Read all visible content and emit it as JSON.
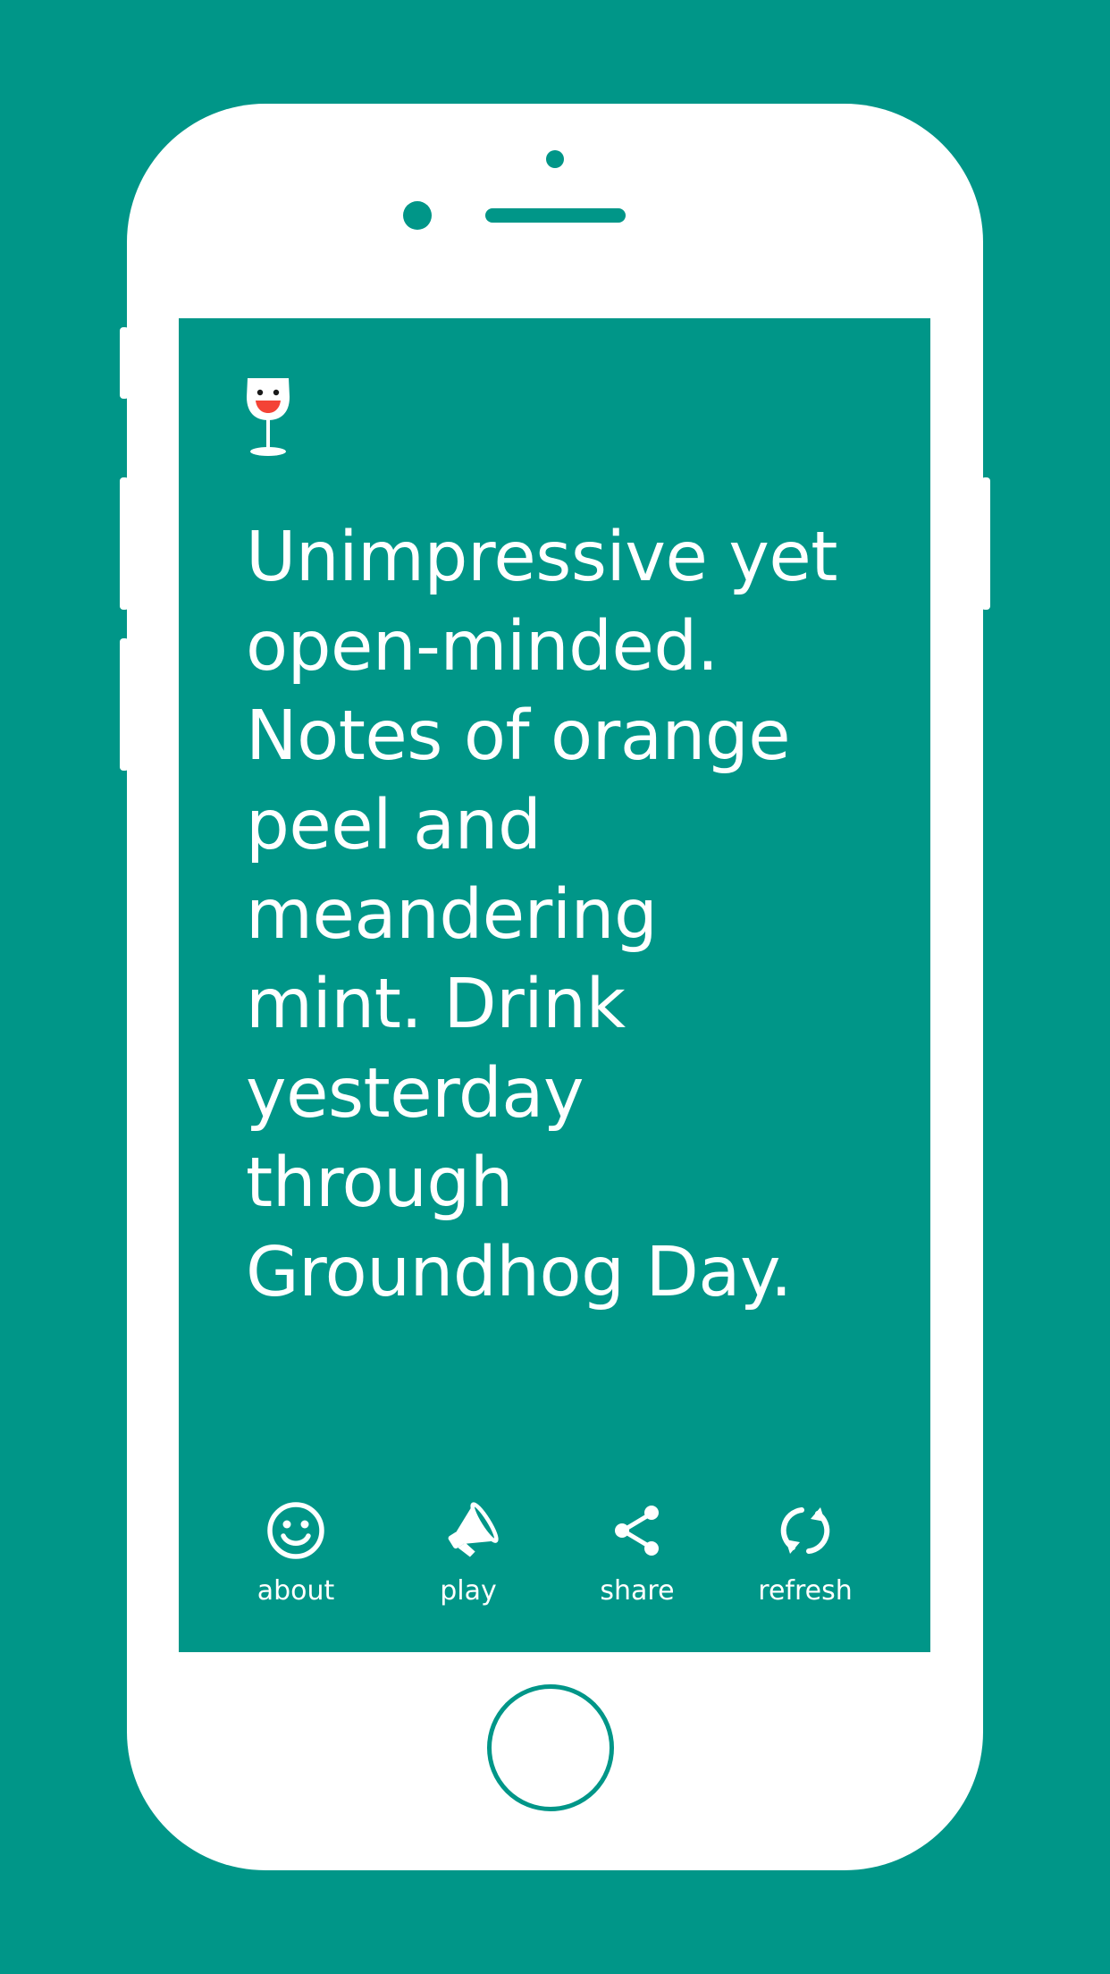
{
  "colors": {
    "background": "#009688",
    "phone_body": "#ffffff",
    "text": "#ffffff",
    "logo_mouth": "#f44336"
  },
  "app": {
    "logo_icon": "wine-glass-face-icon",
    "review_lines": [
      "Unimpressive yet",
      "open-minded.",
      "Notes of orange",
      "peel and",
      "meandering",
      "mint. Drink",
      "yesterday",
      "through",
      "Groundhog Day."
    ]
  },
  "toolbar": {
    "items": [
      {
        "label": "about",
        "icon": "smiley-icon"
      },
      {
        "label": "play",
        "icon": "megaphone-icon"
      },
      {
        "label": "share",
        "icon": "share-icon"
      },
      {
        "label": "refresh",
        "icon": "refresh-icon"
      }
    ]
  }
}
